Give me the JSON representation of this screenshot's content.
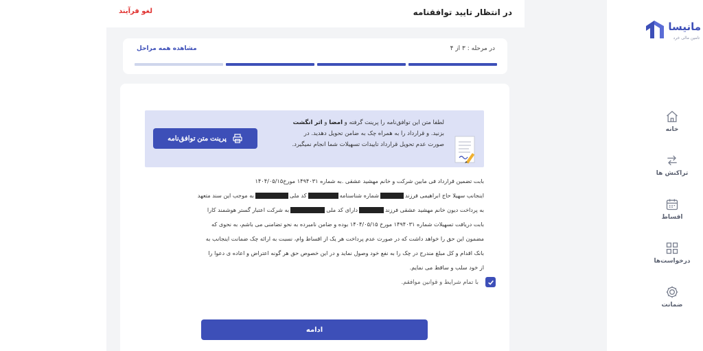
{
  "brand": {
    "name": "مانیسا",
    "tagline": "تامین مالی خرد"
  },
  "sidebar": {
    "items": [
      {
        "label": "خانه"
      },
      {
        "label": "تراکنش ها"
      },
      {
        "label": "اقساط"
      },
      {
        "label": "درخواست‌ها"
      },
      {
        "label": "ضمانت"
      }
    ]
  },
  "header": {
    "title": "در انتظار تایید توافقنامه",
    "cancel_label": "لغو فرآیند"
  },
  "steps": {
    "progress_text": "در مرحله : ۳ از ۴",
    "view_all_label": "مشاهده همه مراحل",
    "total": 4,
    "current": 3
  },
  "notice": {
    "line1_a": "لطفا متن این توافق‌نامه را پرینت گرفته و ",
    "line1_b": "امضا",
    "line1_c": " و ",
    "line1_d": "اثر انگشت",
    "line2": "بزنید. و قرارداد را به همراه چک به ضامن تحویل دهدید. در",
    "line3": "صورت عدم تحویل قرارداد تاییدات تسهیلات شما انجام نمیگیرد.",
    "print_label": "پرینت متن توافق‌نامه"
  },
  "agreement": {
    "line1": "بابت تضمین قرارداد فی مابین شرکت و خانم مهشید عشقی .به شماره ۱۴۹۴۰۳۱ مورخ۱۴۰۴/۰۵/۱۵",
    "line2_a": "اینجانب سهیلا حاج ابراهیمی فرزند",
    "line2_b": "شماره شناسنامه",
    "line2_c": "کد ملی",
    "line2_d": "به موجب این سند متعهد",
    "line3_a": "به پرداخت دیون خانم مهشید عشقی فرزند",
    "line3_b": "دارای کد ملی",
    "line3_c": "به شرکت اعتبار گستر هوشمند کارا",
    "line4": "بابت دریافت تسهیلات شماره ۱۴۹۴۰۳۱ مورخ ۱۴۰۴/۰۵/۱۵ بوده و ضامن نامبرده به نحو تضامنی می باشم، به نحوی که",
    "line5": "مضمون این حق را خواهد داشت که در صورت عدم پرداخت هر یک از اقساط وام، نسبت به ارائه چک ضمانت اینجانب به",
    "line6": "بانک اقدام و کل مبلغ مندرج در چک را به نفع خود وصول نماید و در این خصوص حق هر گونه اعتراض و اعاده ی دعوا را",
    "line7": "از خود سلب و ساقط می نمایم."
  },
  "terms": {
    "label": "با تمام شرایط و قوانین موافقم.",
    "checked": true
  },
  "actions": {
    "continue_label": "ادامه"
  },
  "colors": {
    "primary": "#3d4fb8",
    "danger": "#e0302e",
    "step_pending": "#cfd6ec",
    "notice_bg": "#dde1f6"
  }
}
